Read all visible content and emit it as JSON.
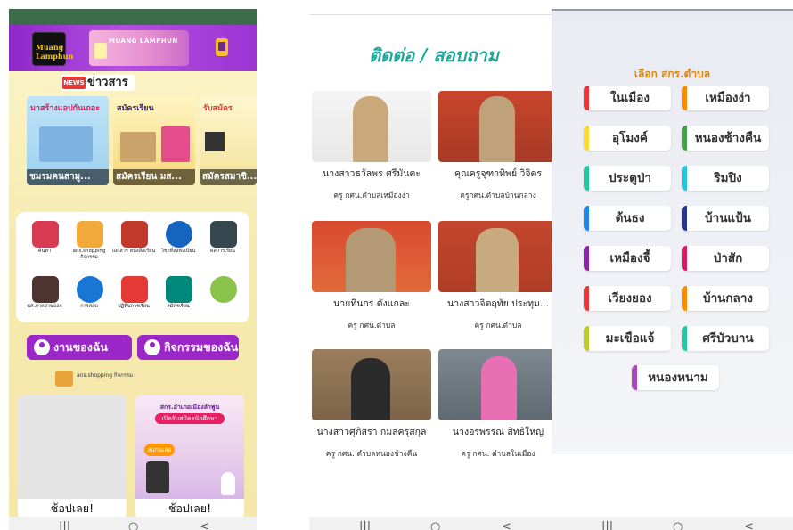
{
  "screen1": {
    "app_logo_text": "Muang Lamphun",
    "banner_text": "MUANG LAMPHUN",
    "news_badge": "NEWS",
    "news_title": "ข่าวสาร",
    "news_cards": [
      {
        "title": "มาสร้างแอปกันเถอะ",
        "caption": "ชมรมคนสามู..."
      },
      {
        "title": "สมัครเรียน",
        "caption": "สมัครเรียน มส..."
      },
      {
        "title": "รับสมัคร",
        "caption": "สมัครสมาชิ..."
      }
    ],
    "menu_icons": [
      {
        "label": "ค้นหา",
        "icon": "search-icon",
        "color": "#d83a52"
      },
      {
        "label": "ans.shopping กิจกรรม",
        "icon": "shop-icon",
        "color": "#f2a93b"
      },
      {
        "label": "เอกสาร หนังสือเรียน",
        "icon": "books-icon",
        "color": "#c0392b"
      },
      {
        "label": "วิชาที่ลงทะเบียน",
        "icon": "folder-icon",
        "color": "#1565c0"
      },
      {
        "label": "ผลการเรียน",
        "icon": "monitor-icon",
        "color": "#37474f"
      },
      {
        "label": "นศ.ภาคอ่านออก",
        "icon": "hands-icon",
        "color": "#4e342e"
      },
      {
        "label": "การสอบ",
        "icon": "checklist-icon",
        "color": "#1976d2"
      },
      {
        "label": "ปฏิทินการเรียน",
        "icon": "calendar-icon",
        "color": "#e53935"
      },
      {
        "label": "สมัครเรียน",
        "icon": "presenter-icon",
        "color": "#00897b"
      },
      {
        "label": "",
        "icon": "school-icon",
        "color": "#8bc34a"
      }
    ],
    "my_work_label": "งานของฉัน",
    "my_activity_label": "กิจกรรมของฉัน",
    "shop_label": "ans.shopping กิจกรรม",
    "products": [
      {
        "label": "ช้อปเลย!"
      },
      {
        "label": "ช้อปเลย!",
        "poster_title": "สกร.อำเภอเมืองลำพูน",
        "poster_sub": "เปิดรับสมัครนักศึกษา",
        "poster_tag": "สแกนเลย"
      }
    ],
    "nav": {
      "recents": "|||",
      "home": "○",
      "back": "<"
    },
    "colors": {
      "appbar": "#9b34d4",
      "status": "#3d6b4a",
      "accent_button": "#9b27c9",
      "body_bg": "#f6eab0"
    }
  },
  "screen2": {
    "title": "ติดต่อ / สอบถาม",
    "people": [
      {
        "name": "นางสาวธวัลพร ศรีมันตะ",
        "role": "ครู กศน.ตำบลเหมืองง่า"
      },
      {
        "name": "คุณครูจุฑาทิพย์ วิจิตร",
        "role": "ครูกศน.ตำบลบ้านกลาง"
      },
      {
        "name": "นายทินกร ดังแกละ",
        "role": "ครู กศน.ตำบล"
      },
      {
        "name": "นางสาวจิตฤทัย ประทุม...",
        "role": "ครู กศน.ตำบล"
      },
      {
        "name": "นางสาวศุภิสรา กมลครุสกุล",
        "role": "ครู กศน. ตำบลหนองช้างคืน"
      },
      {
        "name": "นางอรพรรณ สิทธิใหญ่",
        "role": "ครู กศน. ตำบลในเมือง"
      }
    ],
    "nav": {
      "recents": "|||",
      "home": "○",
      "back": "<"
    }
  },
  "screen3": {
    "title": "เลือก สกร.ตำบล",
    "districts": [
      {
        "name": "ในเมือง",
        "color": "#e53935"
      },
      {
        "name": "เหมืองง่า",
        "color": "#fb8c00"
      },
      {
        "name": "อุโมงค์",
        "color": "#fdd835"
      },
      {
        "name": "หนองช้างคืน",
        "color": "#43a047"
      },
      {
        "name": "ประตูป่า",
        "color": "#26c6a0"
      },
      {
        "name": "ริมปิง",
        "color": "#26c6da"
      },
      {
        "name": "ต้นธง",
        "color": "#1e88e5"
      },
      {
        "name": "บ้านแป้น",
        "color": "#283593"
      },
      {
        "name": "เหมืองจี้",
        "color": "#8e24aa"
      },
      {
        "name": "ป่าสัก",
        "color": "#d81b60"
      },
      {
        "name": "เวียงยอง",
        "color": "#e53935"
      },
      {
        "name": "บ้านกลาง",
        "color": "#fb8c00"
      },
      {
        "name": "มะเขือแจ้",
        "color": "#c0ca33"
      },
      {
        "name": "ศรีบัวบาน",
        "color": "#26c6a0"
      },
      {
        "name": "หนองหนาม",
        "color": "#ab47bc"
      }
    ],
    "title_color": "#d98a12",
    "nav": {
      "recents": "|||",
      "home": "○",
      "back": "<"
    }
  }
}
